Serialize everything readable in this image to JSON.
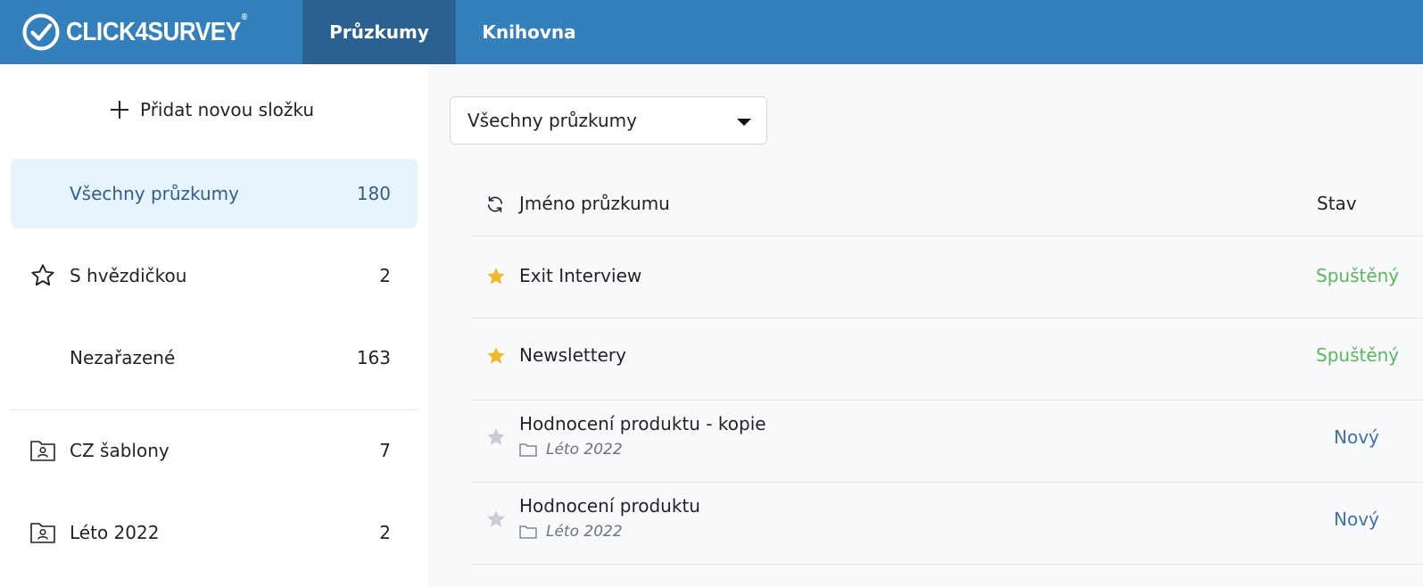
{
  "header": {
    "brand": "CLICK4SURVEY",
    "brand_mark": "®",
    "tabs": [
      {
        "label": "Průzkumy",
        "active": true
      },
      {
        "label": "Knihovna",
        "active": false
      }
    ]
  },
  "sidebar": {
    "add_folder_label": "Přidat novou složku",
    "items": [
      {
        "label": "Všechny průzkumy",
        "count": "180",
        "icon": "none",
        "selected": true
      },
      {
        "label": "S hvězdičkou",
        "count": "2",
        "icon": "star-outline-icon"
      },
      {
        "label": "Nezařazené",
        "count": "163",
        "icon": "none"
      },
      {
        "label": "CZ šablony",
        "count": "7",
        "icon": "folder-user-icon"
      },
      {
        "label": "Léto 2022",
        "count": "2",
        "icon": "folder-user-icon"
      }
    ]
  },
  "main": {
    "filter_value": "Všechny průzkumy",
    "columns": {
      "name": "Jméno průzkumu",
      "status": "Stav"
    },
    "rows": [
      {
        "name": "Exit Interview",
        "folder": "",
        "status": "Spuštěný",
        "starred": true
      },
      {
        "name": "Newslettery",
        "folder": "",
        "status": "Spuštěný",
        "starred": true
      },
      {
        "name": "Hodnocení produktu - kopie",
        "folder": "Léto 2022",
        "status": "Nový",
        "starred": false
      },
      {
        "name": "Hodnocení produktu",
        "folder": "Léto 2022",
        "status": "Nový",
        "starred": false
      }
    ]
  },
  "colors": {
    "header_bg": "#3480bd",
    "active_tab_bg": "#2a6190",
    "selected_item_bg": "#e8f4fd",
    "status_running": "#5cb85c",
    "status_new": "#3d72ad",
    "star_active": "#f0b92a",
    "star_inactive": "#c9ccd3"
  }
}
